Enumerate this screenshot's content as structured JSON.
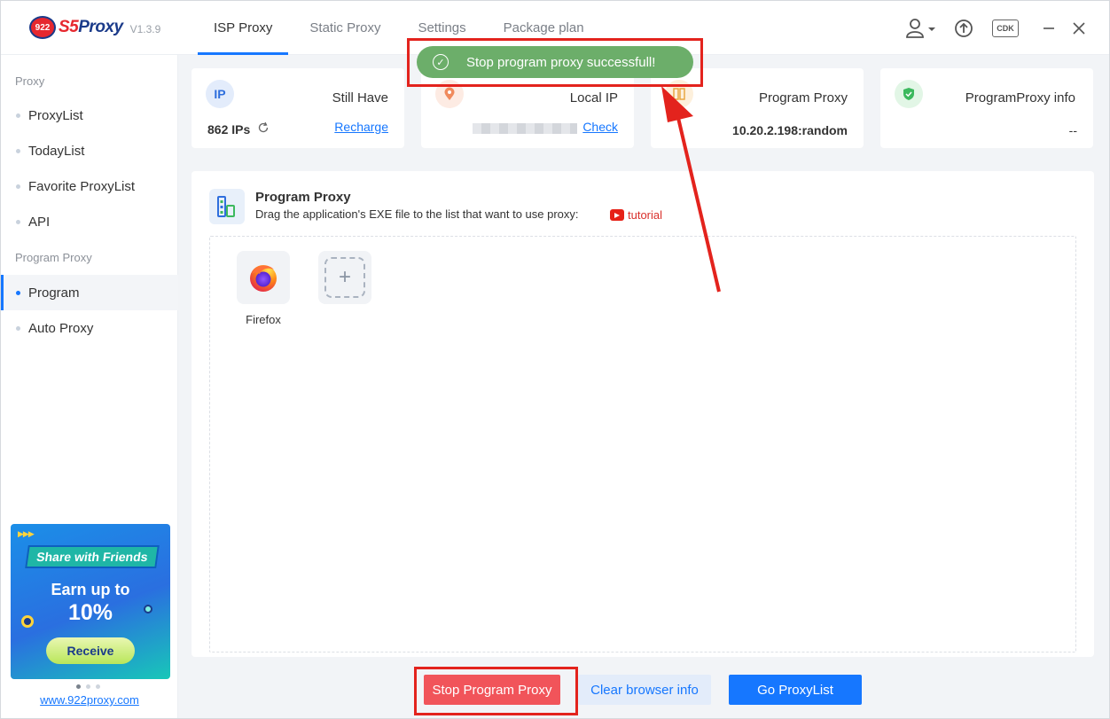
{
  "app": {
    "brand_badge": "922",
    "brand_s5": "S5",
    "brand_name": "Proxy",
    "version": "V1.3.9"
  },
  "tabs": [
    {
      "label": "ISP Proxy",
      "active": true
    },
    {
      "label": "Static Proxy",
      "active": false
    },
    {
      "label": "Settings",
      "active": false
    },
    {
      "label": "Package plan",
      "active": false
    }
  ],
  "header_icons": {
    "user": "user-icon",
    "upload": "upload-icon",
    "cdk": "CDK",
    "minimize": "minimize-icon",
    "close": "close-icon"
  },
  "sidebar": {
    "group_proxy": "Proxy",
    "items_proxy": [
      "ProxyList",
      "TodayList",
      "Favorite ProxyList",
      "API"
    ],
    "group_program": "Program Proxy",
    "items_program": [
      "Program",
      "Auto Proxy"
    ],
    "active_item": "Program",
    "promo": {
      "headline": "Share with Friends",
      "earn": "Earn up to",
      "percent": "10%",
      "button": "Receive"
    },
    "promo_link": "www.922proxy.com"
  },
  "cards": {
    "still_have": {
      "icon_text": "IP",
      "title": "Still Have",
      "value": "862 IPs",
      "link": "Recharge"
    },
    "local_ip": {
      "title": "Local IP",
      "link": "Check"
    },
    "program_proxy": {
      "title": "Program Proxy",
      "value": "10.20.2.198:random"
    },
    "programproxy_info": {
      "title": "ProgramProxy info",
      "value": "--"
    }
  },
  "panel": {
    "title": "Program Proxy",
    "subtitle": "Drag the application's EXE file to the list that want to use proxy:",
    "tutorial": "tutorial",
    "apps": [
      {
        "name": "Firefox",
        "icon": "firefox-icon"
      }
    ],
    "add_symbol": "+"
  },
  "buttons": {
    "stop": "Stop Program Proxy",
    "clear": "Clear browser info",
    "go": "Go ProxyList"
  },
  "toast": {
    "message": "Stop program proxy successfull!"
  },
  "colors": {
    "accent": "#1677ff",
    "stop_button": "#f1545a",
    "toast": "#6cae6a",
    "annotation": "#e3231d"
  }
}
